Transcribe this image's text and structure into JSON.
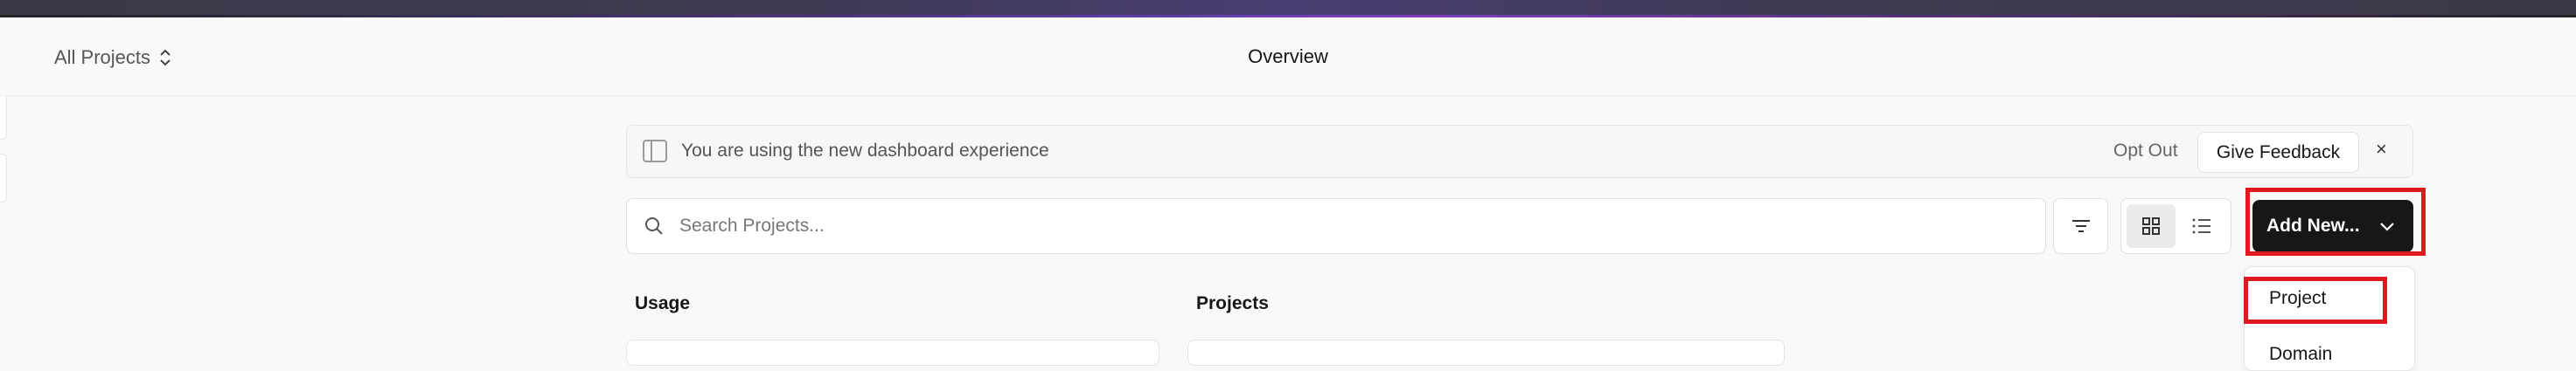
{
  "header": {
    "project_selector": "All Projects",
    "page_title": "Overview"
  },
  "banner": {
    "message": "You are using the new dashboard experience",
    "opt_out": "Opt Out",
    "feedback": "Give Feedback",
    "close": "×"
  },
  "toolbar": {
    "search_placeholder": "Search Projects...",
    "add_new": "Add New..."
  },
  "sections": {
    "usage": "Usage",
    "projects": "Projects"
  },
  "dropdown": {
    "items": [
      "Project",
      "Domain"
    ]
  },
  "colors": {
    "highlight": "#e0191f",
    "primary_button": "#171717"
  }
}
